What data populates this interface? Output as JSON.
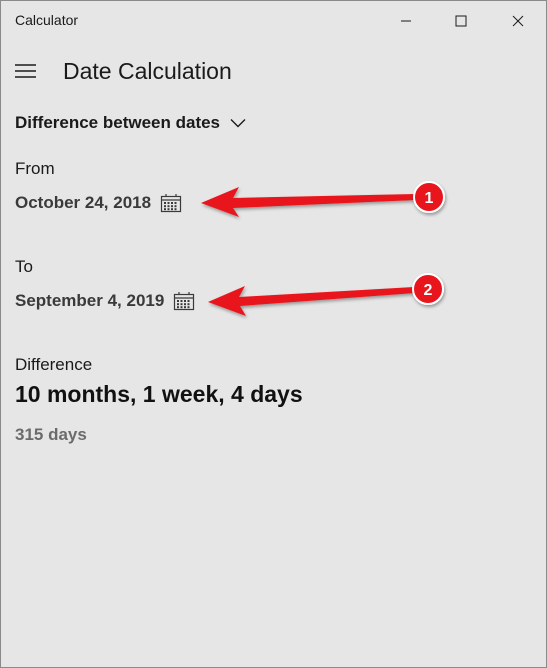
{
  "window": {
    "app_title": "Calculator",
    "page_title": "Date Calculation"
  },
  "mode": {
    "selected": "Difference between dates"
  },
  "from": {
    "label": "From",
    "date": "October 24, 2018"
  },
  "to": {
    "label": "To",
    "date": "September 4, 2019"
  },
  "difference": {
    "label": "Difference",
    "value": "10 months, 1 week, 4 days",
    "days": "315 days"
  },
  "annotations": {
    "badge_1": "1",
    "badge_2": "2",
    "arrow_color": "#e8141b"
  },
  "colors": {
    "background": "#e6e6e6",
    "text": "#1a1a1a",
    "muted_text": "#6b6b6b"
  },
  "icons": {
    "menu": "hamburger-icon",
    "calendar": "calendar-icon",
    "dropdown": "chevron-down-icon"
  }
}
